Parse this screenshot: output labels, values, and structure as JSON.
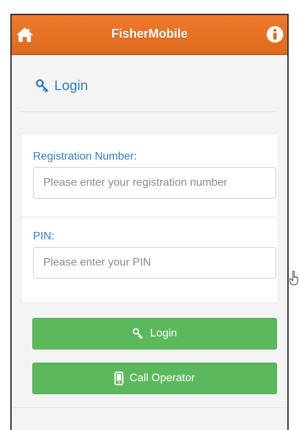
{
  "header": {
    "title": "FisherMobile",
    "home_icon": "home-icon",
    "info_icon": "info-icon",
    "color": "#e8742a"
  },
  "page": {
    "heading": "Login",
    "heading_icon": "key-icon"
  },
  "form": {
    "registration": {
      "label": "Registration Number:",
      "placeholder": "Please enter your registration number",
      "value": ""
    },
    "pin": {
      "label": "PIN:",
      "placeholder": "Please enter your PIN",
      "value": ""
    }
  },
  "buttons": {
    "login": {
      "label": "Login",
      "icon": "key-icon"
    },
    "call_operator": {
      "label": "Call Operator",
      "icon": "phone-icon"
    },
    "color": "#5cb85c"
  }
}
